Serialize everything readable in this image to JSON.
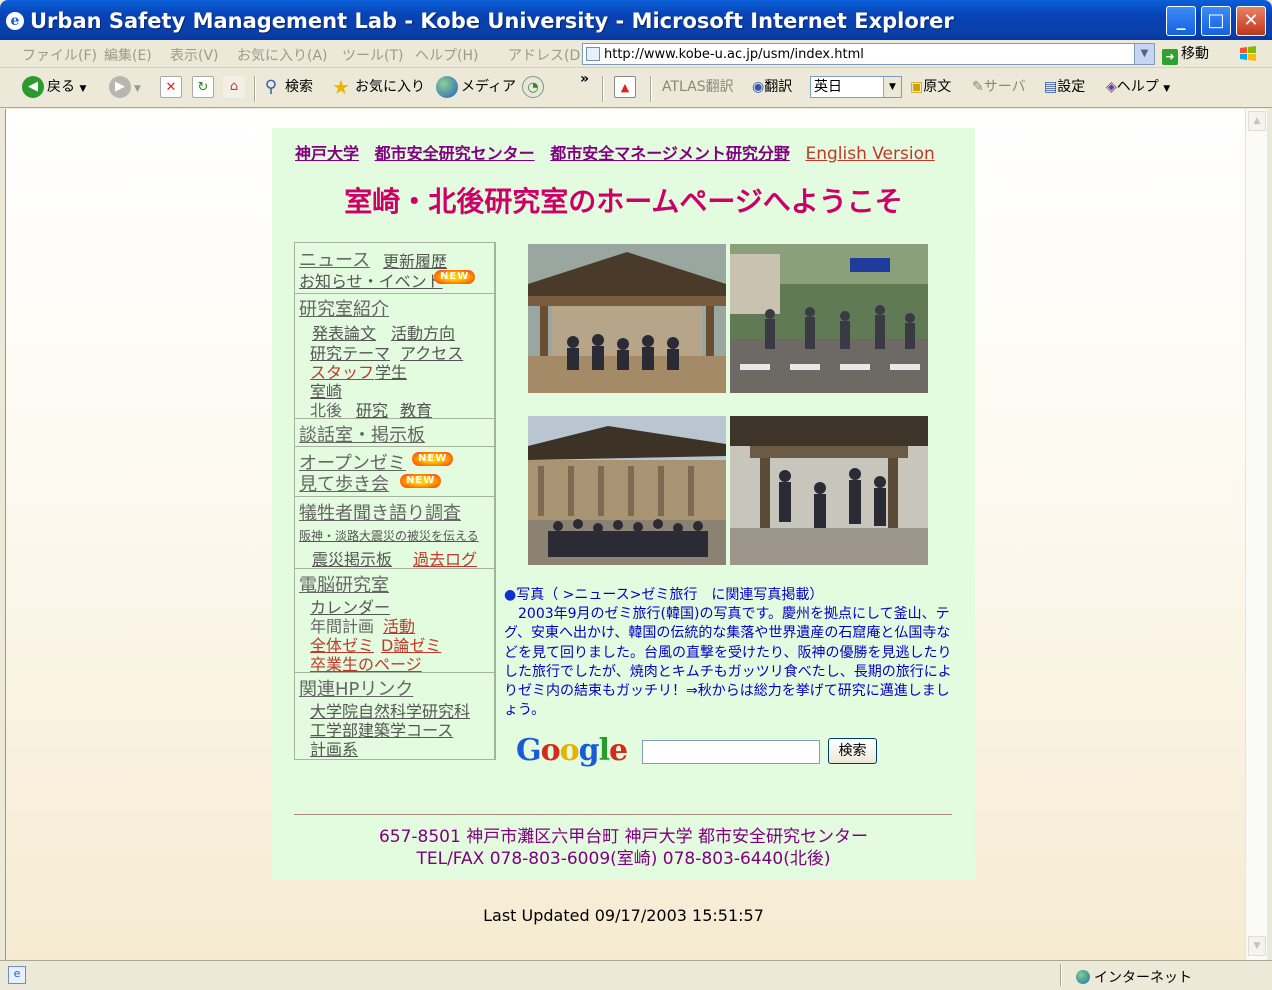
{
  "window": {
    "title": "Urban Safety Management Lab - Kobe University - Microsoft Internet Explorer",
    "minimize": "_",
    "maximize": "□",
    "close": "✕"
  },
  "menubar": {
    "items": [
      "ファイル(F)",
      "編集(E)",
      "表示(V)",
      "お気に入り(A)",
      "ツール(T)",
      "ヘルプ(H)"
    ],
    "address_label": "アドレス(D)",
    "url": "http://www.kobe-u.ac.jp/usm/index.html",
    "go_label": "移動"
  },
  "toolbar": {
    "back": "戻る",
    "search": "検索",
    "favorites": "お気に入り",
    "media": "メディア",
    "chevron": "»",
    "atlas": "ATLAS翻訳",
    "translate": "翻訳",
    "language": "英日",
    "original": "原文",
    "server": "サーバ",
    "settings": "設定",
    "help": "ヘルプ"
  },
  "page": {
    "top_links": [
      "神戸大学",
      "都市安全研究センター",
      "都市安全マネージメント研究分野"
    ],
    "english_link": "English Version",
    "welcome": "室崎・北後研究室のホームページへようこそ",
    "new_badge": "NEW",
    "menu": {
      "news": "ニュース",
      "history": "更新履歴",
      "events": "お知らせ・イベント",
      "lab_intro": "研究室紹介",
      "papers": "発表論文",
      "direction": "活動方向",
      "themes": "研究テーマ",
      "access": "アクセス",
      "staff": "スタッフ",
      "students": "学生",
      "murosaki": "室崎",
      "hokugo": "北後",
      "research": "研究",
      "education": "教育",
      "bbs": "談話室・掲示板",
      "open_seminar": "オープンゼミ",
      "walk": "見て歩き会",
      "victims": "犠牲者聞き語り調査",
      "victims_sub": "阪神・淡路大震災の被災を伝える",
      "quake_bbs": "震災掲示板",
      "past_log": "過去ログ",
      "pc_lab": "電脳研究室",
      "calendar": "カレンダー",
      "annual_plan": "年間計画",
      "activity": "活動",
      "all_seminar": "全体ゼミ",
      "d_seminar": "D論ゼミ",
      "alumni": "卒業生のページ",
      "links": "関連HPリンク",
      "grad_school": "大学院自然科学研究科",
      "arch_course": "工学部建築学コース",
      "planning": "計画系"
    },
    "caption": {
      "bullet": "●",
      "head": "写真（ >ニュース>ゼミ旅行　に関連写真掲載）",
      "body": "　2003年9月のゼミ旅行(韓国)の写真です。慶州を拠点にして釜山、テグ、安東へ出かけ、韓国の伝統的な集落や世界遺産の石窟庵と仏国寺などを見て回りました。台風の直撃を受けたり、阪神の優勝を見逃したりした旅行でしたが、焼肉とキムチもガッツリ食べたし、長期の旅行によりゼミ内の結束もガッチリ！⇒秋からは総力を挙げて研究に邁進しましょう。"
    },
    "google": {
      "logo": "Google",
      "search_button": "検索",
      "query": ""
    },
    "address_line1": "657-8501 神戸市灘区六甲台町 神戸大学 都市安全研究センター",
    "address_line2": "TEL/FAX 078-803-6009(室崎) 078-803-6440(北後)",
    "last_updated": "Last Updated 09/17/2003 15:51:57"
  },
  "statusbar": {
    "zone": "インターネット"
  }
}
